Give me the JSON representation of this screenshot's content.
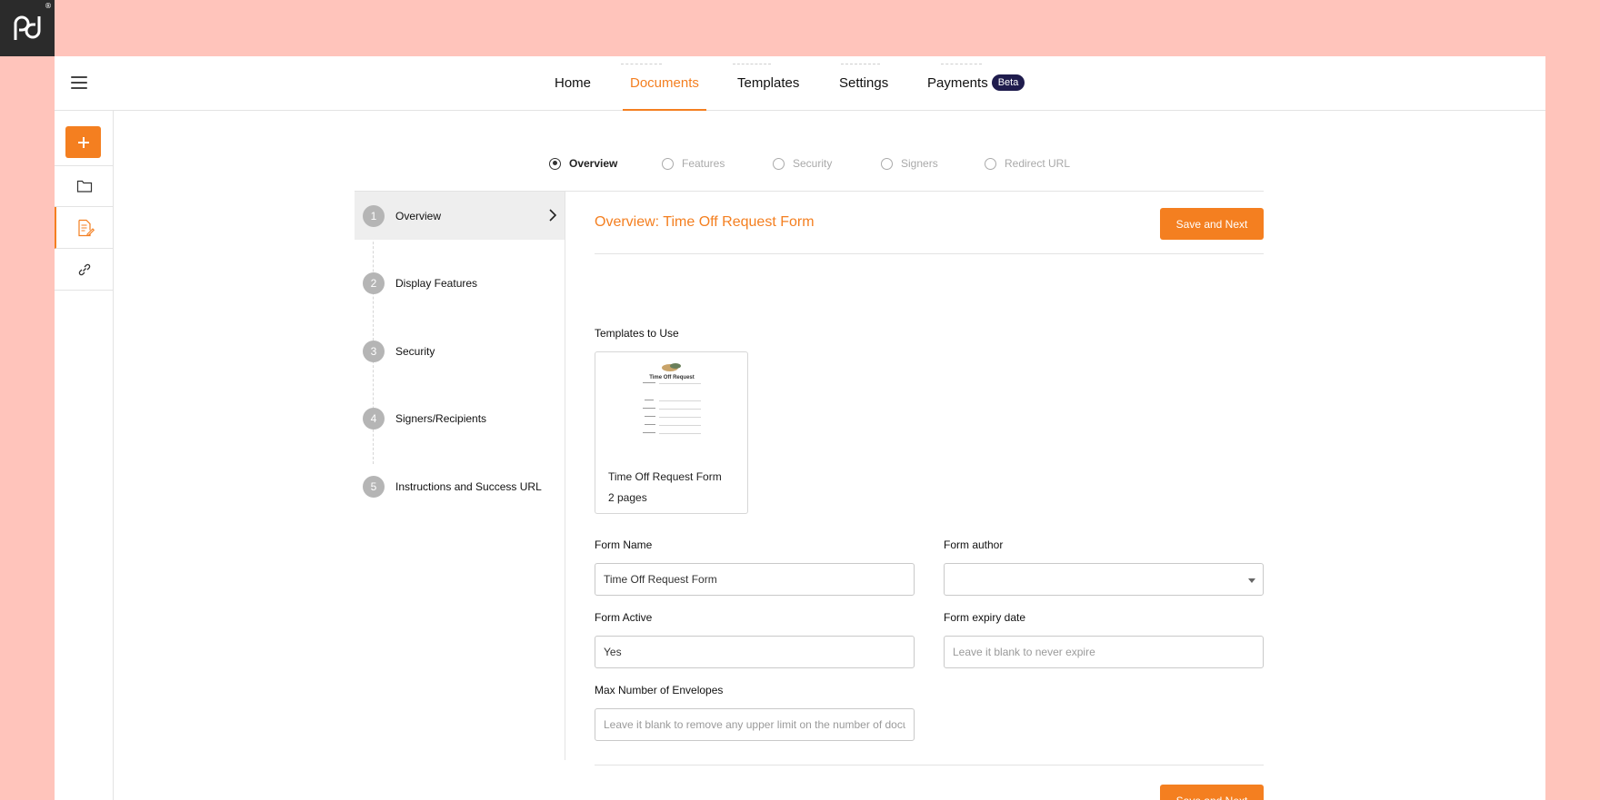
{
  "brand": {
    "logo_text": "pd",
    "accent": "#f47f20",
    "nav_dark": "#1f1c4d"
  },
  "topnav": {
    "menu_icon": "hamburger-icon",
    "items": [
      {
        "label": "Home",
        "active": false
      },
      {
        "label": "Documents",
        "active": true
      },
      {
        "label": "Templates",
        "active": false
      },
      {
        "label": "Settings",
        "active": false
      },
      {
        "label": "Payments",
        "active": false,
        "badge": "Beta"
      }
    ]
  },
  "sidebar": {
    "add_icon": "plus-icon",
    "items": [
      {
        "icon": "folder-icon",
        "active": false
      },
      {
        "icon": "document-edit-icon",
        "active": true
      },
      {
        "icon": "link-icon",
        "active": false
      }
    ]
  },
  "stepper": {
    "steps": [
      {
        "label": "Overview",
        "active": true
      },
      {
        "label": "Features",
        "active": false
      },
      {
        "label": "Security",
        "active": false
      },
      {
        "label": "Signers",
        "active": false
      },
      {
        "label": "Redirect URL",
        "active": false
      }
    ]
  },
  "steps_list": [
    {
      "num": "1",
      "label": "Overview",
      "active": true
    },
    {
      "num": "2",
      "label": "Display Features",
      "active": false
    },
    {
      "num": "3",
      "label": "Security",
      "active": false
    },
    {
      "num": "4",
      "label": "Signers/Recipients",
      "active": false
    },
    {
      "num": "5",
      "label": "Instructions and Success URL",
      "active": false
    }
  ],
  "form": {
    "title": "Overview: Time Off Request Form",
    "save_next_label": "Save and Next",
    "templates_label": "Templates to Use",
    "template": {
      "name": "Time Off Request Form",
      "pages": "2 pages",
      "thumb_title": "Time Off Request"
    },
    "form_name_label": "Form Name",
    "form_name_value": "Time Off Request Form",
    "form_author_label": "Form author",
    "form_author_value": "",
    "form_active_label": "Form Active",
    "form_active_value": "Yes",
    "expiry_label": "Form expiry date",
    "expiry_placeholder": "Leave it blank to never expire",
    "max_env_label": "Max Number of Envelopes",
    "max_env_placeholder": "Leave it blank to remove any upper limit on the number of documents"
  }
}
